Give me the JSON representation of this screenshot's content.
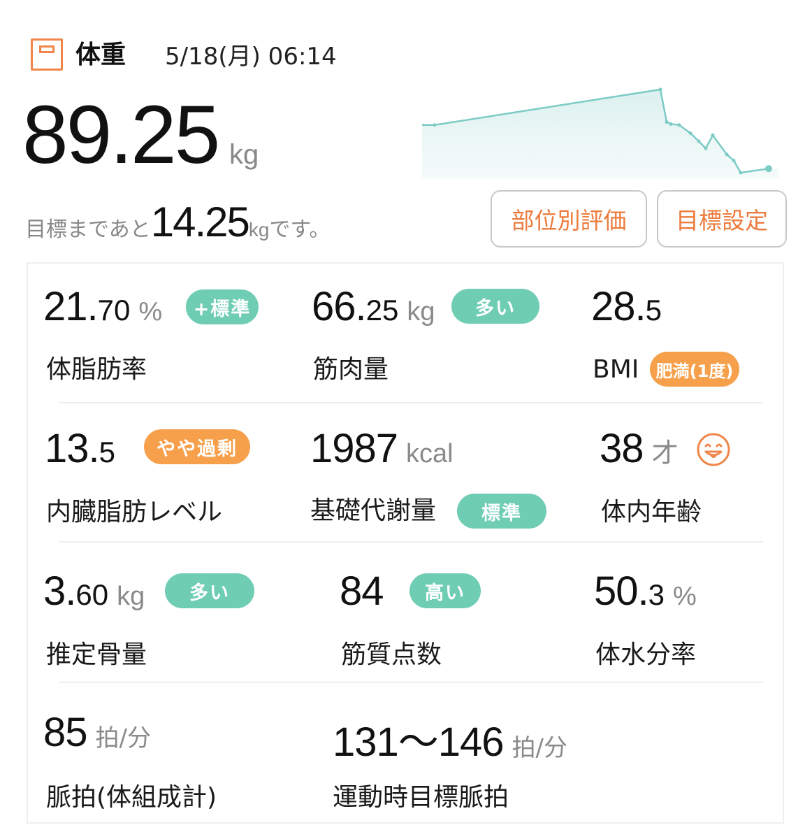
{
  "header": {
    "title": "体重",
    "datetime": "5/18(月) 06:14"
  },
  "weight": {
    "value": "89.25",
    "unit": "kg"
  },
  "goal": {
    "prefix": "目標まであと",
    "value": "14.25",
    "unit": "kg",
    "suffix": "です。"
  },
  "buttons": {
    "body_eval": "部位別評価",
    "goal_setting": "目標設定"
  },
  "trend": {
    "values": [
      89.9,
      93.4,
      90.2,
      90.0,
      89.9,
      89.1,
      88.3,
      87.6,
      88.9,
      87.0,
      86.4,
      85.2,
      85.6
    ]
  },
  "colors": {
    "accent_orange": "#ec7b3c",
    "badge_green": "#6fcdb4",
    "badge_orange": "#f7a04c",
    "chart_line": "#7ccbc5"
  },
  "metrics": {
    "body_fat": {
      "int": "21.",
      "dec": "70",
      "unit": "%",
      "badge": "+標準",
      "label": "体脂肪率"
    },
    "muscle": {
      "int": "66.",
      "dec": "25",
      "unit": "kg",
      "badge": "多い",
      "label": "筋肉量"
    },
    "bmi": {
      "int": "28.",
      "dec": "5",
      "badge": "肥満(1度)",
      "label": "BMI"
    },
    "visceral": {
      "int": "13.",
      "dec": "5",
      "badge": "やや過剰",
      "label": "内臓脂肪レベル"
    },
    "bmr": {
      "int": "1987",
      "unit": "kcal",
      "badge": "標準",
      "label": "基礎代謝量"
    },
    "body_age": {
      "int": "38",
      "unit": "才",
      "icon": "smiley-face-icon",
      "label": "体内年齢"
    },
    "bone": {
      "int": "3.",
      "dec": "60",
      "unit": "kg",
      "badge": "多い",
      "label": "推定骨量"
    },
    "muscle_quality": {
      "int": "84",
      "badge": "高い",
      "label": "筋質点数"
    },
    "water": {
      "int": "50.",
      "dec": "3",
      "unit": "%",
      "label": "体水分率"
    },
    "pulse": {
      "int": "85",
      "unit": "拍/分",
      "label": "脈拍(体組成計)"
    },
    "target_pulse": {
      "int": "131〜146",
      "unit": "拍/分",
      "label": "運動時目標脈拍"
    }
  }
}
